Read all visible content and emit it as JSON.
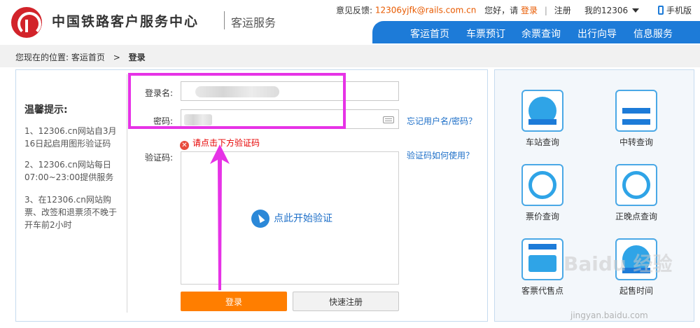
{
  "header": {
    "title": "中国铁路客户服务中心",
    "subtitle": "客运服务",
    "feedback_label": "意见反馈:",
    "feedback_email": "12306yjfk@rails.com.cn",
    "greeting": "您好，请",
    "login_link": "登录",
    "register_link": "注册",
    "my_account": "我的12306",
    "mobile": "手机版"
  },
  "nav": {
    "items": [
      "客运首页",
      "车票预订",
      "余票查询",
      "出行向导",
      "信息服务"
    ]
  },
  "breadcrumb": {
    "prefix": "您现在的位置:",
    "home": "客运首页",
    "separator": ">",
    "current": "登录"
  },
  "tips": {
    "title": "温馨提示:",
    "items": [
      "1、12306.cn网站自3月16日起启用图形验证码",
      "2、12306.cn网站每日07:00~23:00提供服务",
      "3、在12306.cn网站购票、改签和退票须不晚于开车前2小时"
    ]
  },
  "form": {
    "username_label": "登录名:",
    "password_label": "密码:",
    "captcha_label": "验证码:",
    "forgot_link": "忘记用户名/密码？",
    "captcha_help_link": "验证码如何使用？",
    "error_text": "请点击下方验证码",
    "captcha_start": "点此开始验证",
    "login_button": "登录",
    "register_button": "快速注册"
  },
  "services": [
    {
      "label": "车站查询",
      "icon": "station-icon"
    },
    {
      "label": "中转查询",
      "icon": "transfer-icon"
    },
    {
      "label": "票价查询",
      "icon": "fare-search-icon"
    },
    {
      "label": "正晚点查询",
      "icon": "clock-icon"
    },
    {
      "label": "客票代售点",
      "icon": "ticket-agent-icon"
    },
    {
      "label": "起售时间",
      "icon": "sale-time-icon"
    }
  ],
  "watermark": {
    "brand": "Baidu 经验",
    "url": "jingyan.baidu.com"
  },
  "colors": {
    "nav_blue": "#1d7bd8",
    "brand_red": "#d2232a",
    "login_orange": "#ff7e00",
    "annotation_magenta": "#e633e6",
    "error_red": "#e60000",
    "link_blue": "#1d6fc8"
  }
}
